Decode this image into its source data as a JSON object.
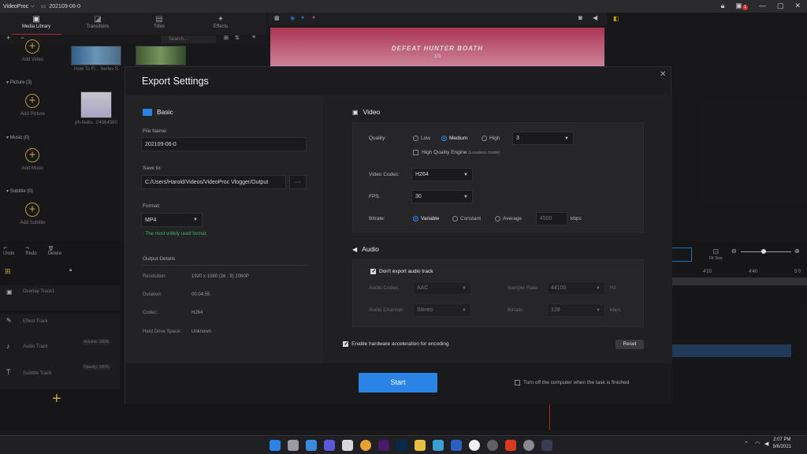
{
  "titlebar": {
    "app_name": "VideoProc",
    "project_name": "202109-06-0",
    "notif_count": "1"
  },
  "library": {
    "tabs": [
      {
        "label": "Media Library"
      },
      {
        "label": "Transitions"
      },
      {
        "label": "Titles"
      },
      {
        "label": "Effects"
      }
    ],
    "search_placeholder": "Search...",
    "video_add_label": "Add Video",
    "video_thumbs": [
      {
        "caption": "How To Fi... Series S"
      },
      {
        "caption": ""
      }
    ],
    "sections": [
      {
        "name": "Picture",
        "count": "(3)",
        "add_label": "Add Picture",
        "thumb_caption": "ph-featu...04564560"
      },
      {
        "name": "Music",
        "count": "(0)",
        "add_label": "Add Music"
      },
      {
        "name": "Subtitle",
        "count": "(0)",
        "add_label": "Add Subtitle"
      }
    ]
  },
  "preview": {
    "overlay_title": "DEFEAT HUNTER BOATH",
    "overlay_sub": "1/3"
  },
  "timeline": {
    "tools": [
      {
        "label": "Undo"
      },
      {
        "label": "Redo"
      },
      {
        "label": "Delete"
      }
    ],
    "tracks": [
      {
        "name": "Overlay Track1"
      },
      {
        "name": "Effect Track"
      },
      {
        "name": "Audio Track",
        "extra": "Volume: 100%"
      },
      {
        "name": "Subtitle Track",
        "extra": "Opacity: 100%"
      }
    ],
    "ruler": [
      "4'20",
      "4'40",
      "5'0"
    ],
    "fit_label": "Fit Size"
  },
  "export": {
    "title": "Export Settings",
    "basic": {
      "header": "Basic",
      "file_name_label": "File Name:",
      "file_name": "202109-06-0",
      "save_to_label": "Save to:",
      "save_path": "C:/Users/Harold/Videos/VideoProc Vlogger/Output",
      "browse": "···",
      "format_label": "Format:",
      "format": "MP4",
      "format_hint": "· The most widely used format."
    },
    "details": {
      "header": "Output Details",
      "rows": [
        {
          "key": "Resolution:",
          "value": "1920 x 1080   (16 : 9)  1080P"
        },
        {
          "key": "Duration:",
          "value": "00:04:55"
        },
        {
          "key": "Codec:",
          "value": "H264"
        },
        {
          "key": "Hard Drive Space:",
          "value": "Unknown"
        }
      ]
    },
    "video": {
      "header": "Video",
      "quality_label": "Quality:",
      "quality_options": [
        "Low",
        "Medium",
        "High"
      ],
      "quality_selected": "Medium",
      "quality_level": "3",
      "hq_engine_label": "High Quality Engine",
      "hq_engine_note": "(Lossless mode)",
      "codec_label": "Video Codec:",
      "codec": "H264",
      "fps_label": "FPS:",
      "fps": "30",
      "bitrate_label": "Bitrate:",
      "bitrate_options": [
        "Variable",
        "Constant",
        "Average"
      ],
      "bitrate_selected": "Variable",
      "bitrate_value": "4500",
      "bitrate_unit": "kbps"
    },
    "audio": {
      "header": "Audio",
      "dont_export_label": "Don't export audio track",
      "codec_label": "Audio Codec:",
      "codec": "AAC",
      "sample_rate_label": "Sample Rate:",
      "sample_rate": "44100",
      "sample_rate_unit": "Hz",
      "channel_label": "Audio Channel:",
      "channel": "Stereo",
      "bitrate_label": "Bitrate:",
      "bitrate": "128",
      "bitrate_unit": "kbps"
    },
    "hw_accel_label": "Enable hardware acceleration for encoding",
    "reset_label": "Reset",
    "start_label": "Start",
    "shutdown_label": "Turn off the computer when the task is finished"
  },
  "taskbar": {
    "time": "2:07 PM",
    "date": "9/6/2021"
  }
}
